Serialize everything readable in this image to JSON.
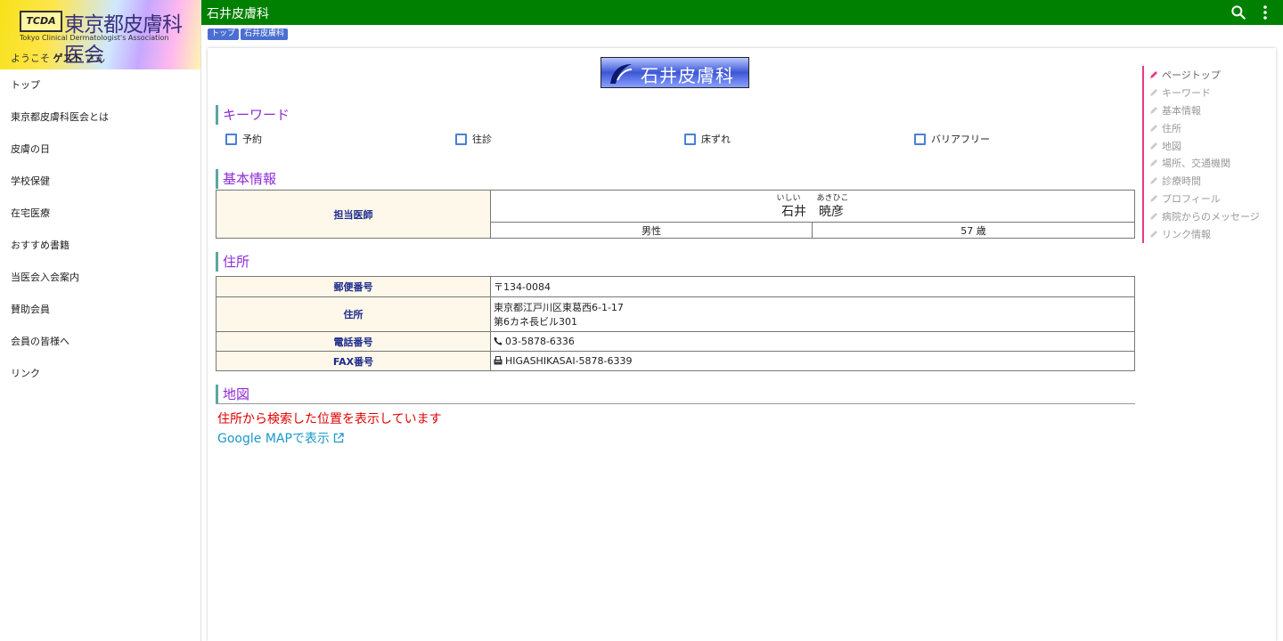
{
  "brand": {
    "logo_mark": "TCDA",
    "title": "東京都皮膚科医会",
    "subtitle": "Tokyo Clinical Dermatologist's Association",
    "welcome_prefix": "ようこそ",
    "user": "ゲスト",
    "welcome_suffix": "さん"
  },
  "nav": [
    "トップ",
    "東京都皮膚科医会とは",
    "皮膚の日",
    "学校保健",
    "在宅医療",
    "おすすめ書籍",
    "当医会入会案内",
    "賛助会員",
    "会員の皆様へ",
    "リンク"
  ],
  "topbar": {
    "title": "石井皮膚科",
    "search_icon": "search-icon",
    "more_icon": "more-vert-icon"
  },
  "breadcrumb": [
    "トップ",
    "石井皮膚科"
  ],
  "clinic": {
    "logo_text": "石井皮膚科"
  },
  "sections": {
    "keyword": "キーワード",
    "basic": "基本情報",
    "address": "住所",
    "map": "地図"
  },
  "keywords": [
    "予約",
    "往診",
    "床ずれ",
    "バリアフリー"
  ],
  "basic": {
    "doctor_label": "担当医師",
    "ruby_family": "いしい",
    "ruby_given": "あきひこ",
    "name_family": "石井",
    "name_given": "暁彦",
    "gender": "男性",
    "age": "57 歳"
  },
  "address": {
    "postal_label": "郵便番号",
    "postal": "〒134-0084",
    "addr_label": "住所",
    "addr_line1": "東京都江戸川区東葛西6-1-17",
    "addr_line2": "第6カネ長ビル301",
    "tel_label": "電話番号",
    "tel": "03-5878-6336",
    "fax_label": "FAX番号",
    "fax": "HIGASHIKASAI-5878-6339"
  },
  "map": {
    "note": "住所から検索した位置を表示しています",
    "link": "Google MAPで表示"
  },
  "toc": [
    "ページトップ",
    "キーワード",
    "基本情報",
    "住所",
    "地図",
    "場所、交通機関",
    "診療時間",
    "プロフィール",
    "病院からのメッセージ",
    "リンク情報"
  ],
  "colors": {
    "topbar": "#008000",
    "accent_purple": "#8e2bd6",
    "toc_accent": "#e83a8c",
    "link": "#1a97c9",
    "note_red": "#e00000"
  }
}
